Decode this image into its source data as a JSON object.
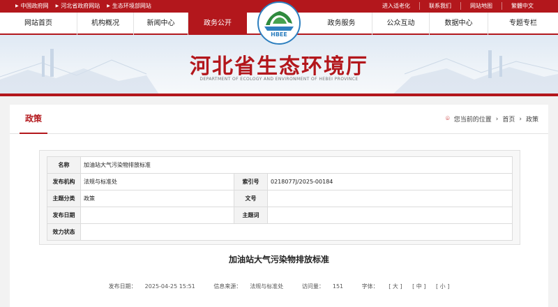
{
  "topbar": {
    "links_left": [
      "中国政府网",
      "河北省政府网站",
      "生态环境部网站"
    ],
    "links_right": [
      "进入适老化",
      "联系我们",
      "网站地图",
      "繁體中文"
    ]
  },
  "nav": {
    "items": [
      {
        "label": "网站首页"
      },
      {
        "label": "机构概况"
      },
      {
        "label": "新闻中心"
      },
      {
        "label": "政务公开",
        "active": true
      },
      {
        "label": "政务服务"
      },
      {
        "label": "公众互动"
      },
      {
        "label": "数据中心"
      },
      {
        "label": "专题专栏"
      }
    ]
  },
  "logo": {
    "text": "HBEE"
  },
  "banner": {
    "title": "河北省生态环境厅",
    "subtitle": "DEPARTMENT OF ECOLOGY AND ENVIRONMENT OF HEBEI PROVINCE"
  },
  "section": {
    "title": "政策",
    "location_label": "您当前的位置",
    "breadcrumb": [
      "首页",
      "政策"
    ]
  },
  "info": {
    "name_label": "名称",
    "name_value": "加油站大气污染物排放标准",
    "agency_label": "发布机构",
    "agency_value": "法规与标准处",
    "index_label": "索引号",
    "index_value": "0218077J/2025-00184",
    "category_label": "主题分类",
    "category_value": "政策",
    "docno_label": "文号",
    "docno_value": "",
    "date_label": "发布日期",
    "date_value": "",
    "keywords_label": "主题词",
    "keywords_value": "",
    "status_label": "效力状态",
    "status_value": ""
  },
  "document": {
    "title": "加油站大气污染物排放标准",
    "publish_label": "发布日期：",
    "publish_value": "2025-04-25 15:51",
    "source_label": "信息来源：",
    "source_value": "法规与标准处",
    "views_label": "访问量：",
    "views_value": "151",
    "font_label": "字体：",
    "font_large": "[ 大 ]",
    "font_medium": "[ 中 ]",
    "font_small": "[ 小 ]"
  },
  "colors": {
    "brand": "#b3171c",
    "banner_bg": "#e6eef6"
  }
}
